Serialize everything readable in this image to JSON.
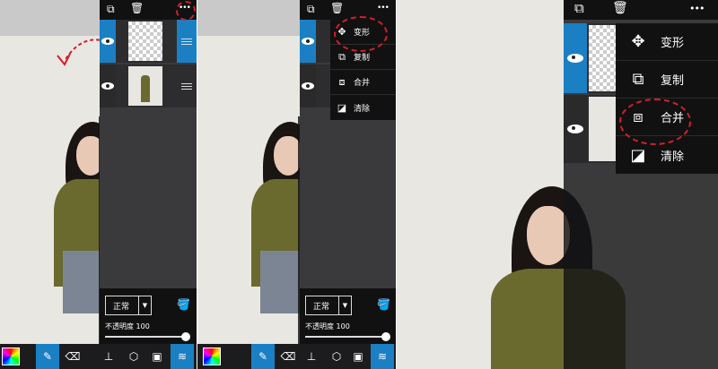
{
  "top_toolbar": {
    "more_icon": "•••"
  },
  "menu": {
    "items": [
      {
        "icon": "move-icon",
        "label": "变形"
      },
      {
        "icon": "duplicate-icon",
        "label": "复制"
      },
      {
        "icon": "merge-icon",
        "label": "合并"
      },
      {
        "icon": "eraser-icon",
        "label": "清除"
      }
    ]
  },
  "layer_panel": {
    "blend_mode": "正常",
    "opacity_label": "不透明度 100",
    "opacity": 1.0
  },
  "highlight_color": "#d0202c",
  "accent_color": "#1b7fc4"
}
